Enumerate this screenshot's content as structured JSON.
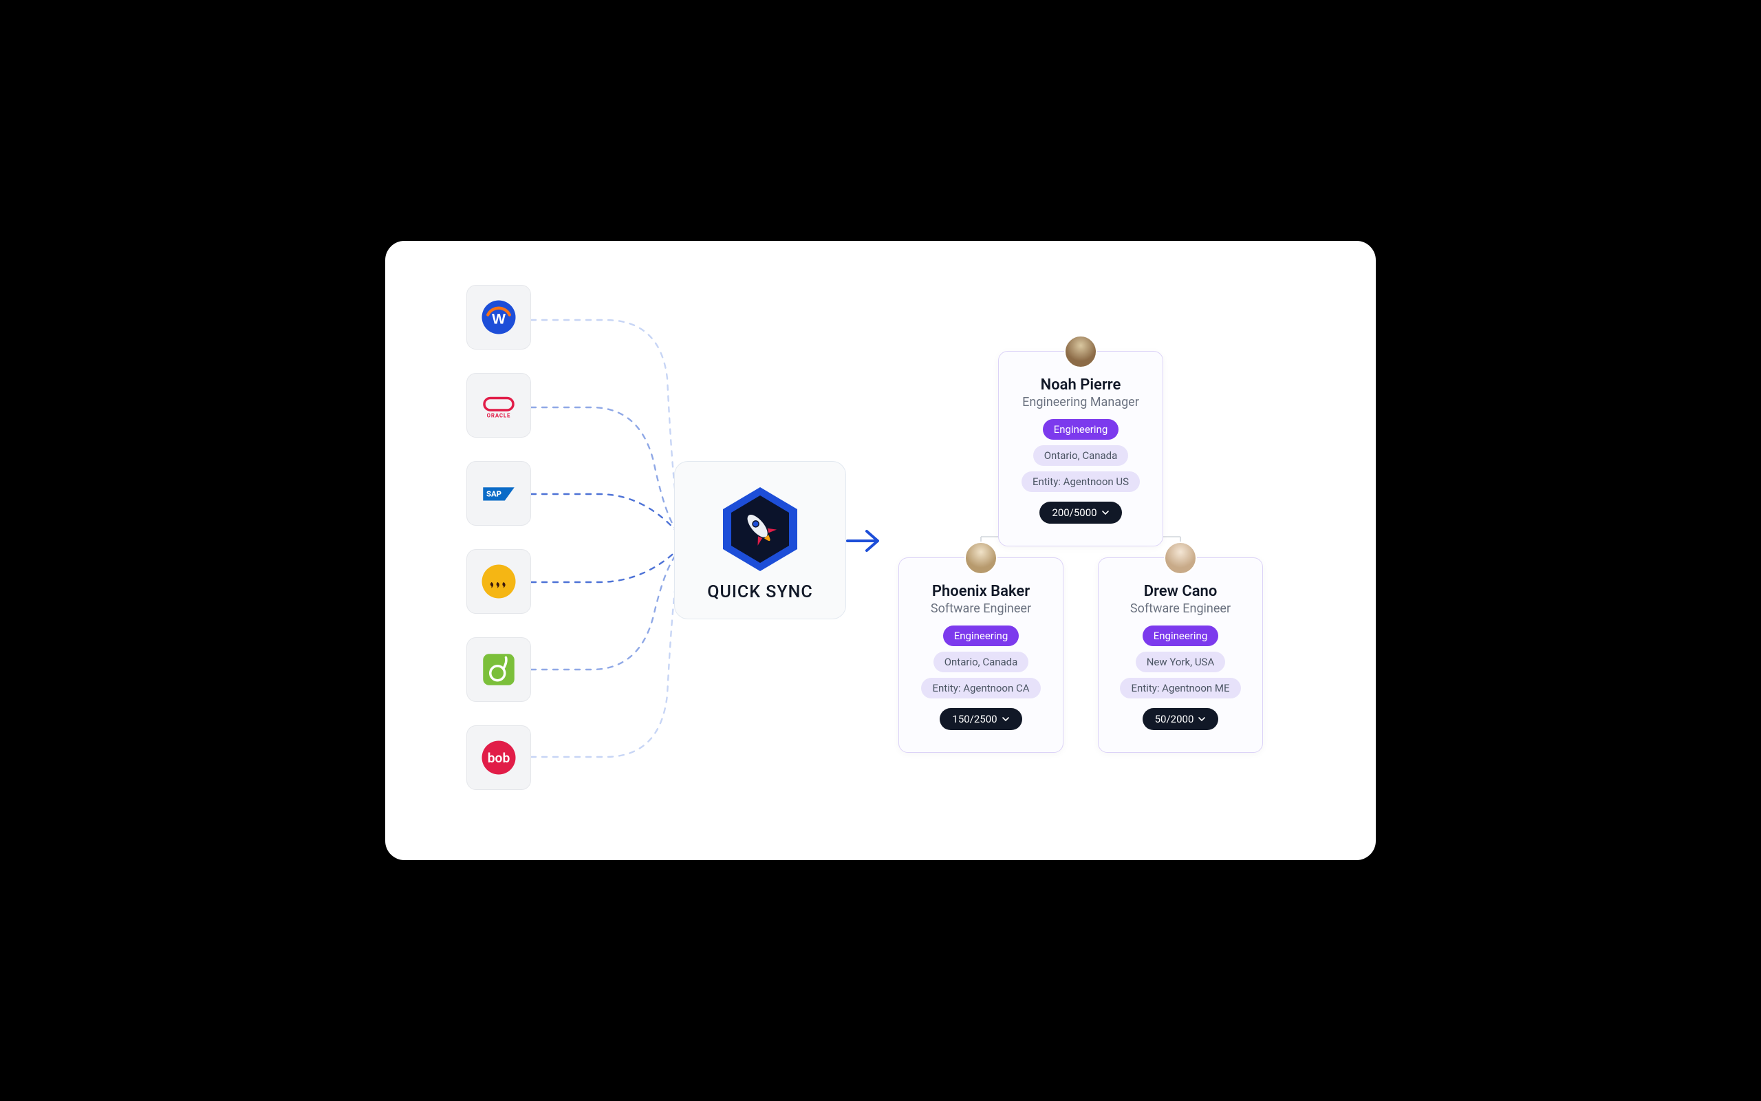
{
  "integrations": [
    {
      "id": "workday",
      "name": "Workday"
    },
    {
      "id": "oracle",
      "name": "Oracle"
    },
    {
      "id": "sap",
      "name": "SAP"
    },
    {
      "id": "rippling",
      "name": "Rippling"
    },
    {
      "id": "bamboo",
      "name": "BambooHR"
    },
    {
      "id": "bob",
      "name": "bob"
    }
  ],
  "sync": {
    "label": "QUICK SYNC"
  },
  "org": {
    "manager": {
      "name": "Noah Pierre",
      "role": "Engineering Manager",
      "department": "Engineering",
      "location": "Ontario, Canada",
      "entity": "Entity: Agentnoon US",
      "stats": "200/5000"
    },
    "reports": [
      {
        "name": "Phoenix Baker",
        "role": "Software Engineer",
        "department": "Engineering",
        "location": "Ontario, Canada",
        "entity": "Entity: Agentnoon CA",
        "stats": "150/2500"
      },
      {
        "name": "Drew Cano",
        "role": "Software Engineer",
        "department": "Engineering",
        "location": "New York, USA",
        "entity": "Entity: Agentnoon ME",
        "stats": "50/2000"
      }
    ]
  },
  "colors": {
    "accent": "#7c3aed",
    "blue": "#1d4ed8",
    "orange": "#f97316"
  }
}
